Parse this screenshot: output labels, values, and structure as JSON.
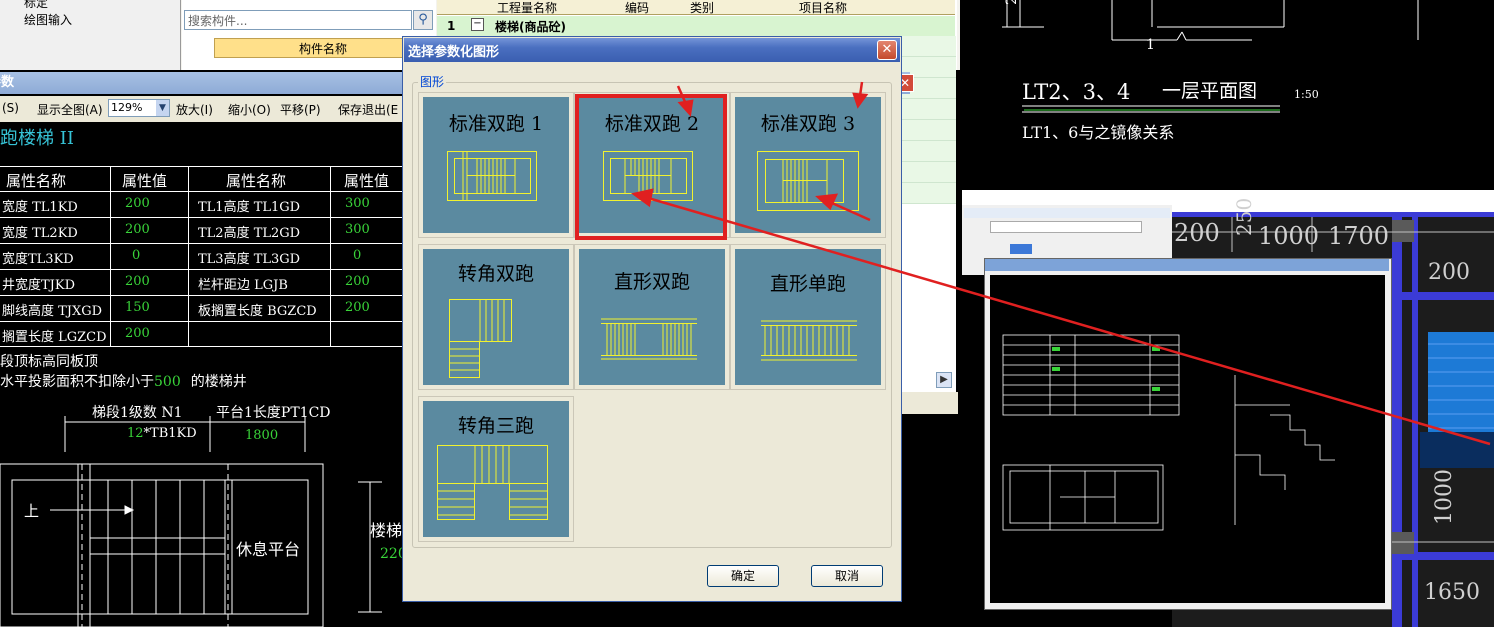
{
  "nav": {
    "item1": "标定",
    "item2": "绘图输入"
  },
  "component_panel": {
    "search_placeholder": "搜索构件...",
    "column_header": "构件名称"
  },
  "grid": {
    "headers": [
      "工程量名称",
      "编码",
      "类别",
      "项目名称"
    ],
    "row1_num": "1",
    "row1_toggle": "−",
    "row1_name": "楼梯(商品砼)"
  },
  "param_window": {
    "title": "参数",
    "toolbar": {
      "item0": "(S)",
      "fit_all": "显示全图(A)",
      "zoom_value": "129%",
      "zoom_in": "放大(I)",
      "zoom_out": "缩小(O)",
      "pan": "平移(P)",
      "save_exit": "保存退出(E"
    },
    "heading": "跑楼梯 II",
    "table_headers": [
      "属性名称",
      "属性值",
      "属性名称",
      "属性值"
    ],
    "rows": [
      {
        "n1": "宽度 TL1KD",
        "v1": "200",
        "n2": "TL1高度 TL1GD",
        "v2": "300"
      },
      {
        "n1": "宽度 TL2KD",
        "v1": "200",
        "n2": "TL2高度 TL2GD",
        "v2": "300"
      },
      {
        "n1": "宽度TL3KD",
        "v1": "0",
        "n2": "TL3高度 TL3GD",
        "v2": "0"
      },
      {
        "n1": "井宽度TJKD",
        "v1": "200",
        "n2": "栏杆距边 LGJB",
        "v2": "200"
      },
      {
        "n1": "脚线高度 TJXGD",
        "v1": "150",
        "n2": "板搁置长度 BGZCD",
        "v2": "200"
      },
      {
        "n1": "搁置长度 LGZCD",
        "v1": "200",
        "n2": "",
        "v2": ""
      }
    ],
    "note1": "段顶标高同板顶",
    "note2_a": "水平投影面积不扣除小于",
    "note2_num": "500",
    "note2_b": "的楼梯井",
    "dim1_label": "梯段1级数 N1",
    "dim1_value_num": "12",
    "dim1_value_text": "*TB1KD",
    "dim2_label": "平台1长度PT1CD",
    "dim2_value": "1800",
    "up_label": "上",
    "landing_label": "休息平台",
    "stair_label_partial": "楼梯",
    "stair_value_partial": "220"
  },
  "dialog": {
    "title": "选择参数化图形",
    "group_label": "图形",
    "tiles": [
      {
        "label": "标准双跑 1"
      },
      {
        "label": "标准双跑 2"
      },
      {
        "label": "标准双跑 3"
      },
      {
        "label": "转角双跑"
      },
      {
        "label": "直形双跑"
      },
      {
        "label": "直形单跑"
      },
      {
        "label": "转角三跑"
      }
    ],
    "ok_label": "确定",
    "cancel_label": "取消"
  },
  "right_cad": {
    "dim_250": "250",
    "dim_1": "1",
    "plan_title": "LT2、3、4",
    "plan_subtitle": "一层平面图",
    "scale": "1:50",
    "mirror_note": "LT1、6与之镜像关系",
    "dims": [
      "200",
      "250",
      "1000",
      "1700",
      "200",
      "1000",
      "1650"
    ]
  },
  "colors": {
    "highlight": "#e02020",
    "tile_bg": "#5b8aa0",
    "stair_line": "#f2f22e",
    "cad_green": "#39d339",
    "cad_cyan": "#36c3d6"
  }
}
